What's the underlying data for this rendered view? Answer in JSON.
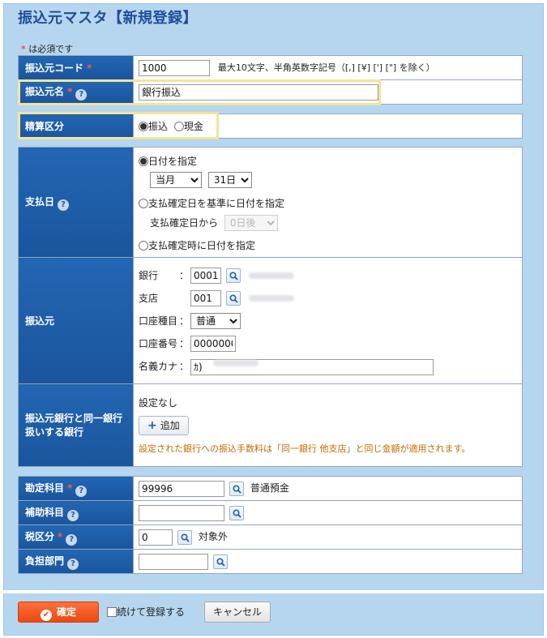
{
  "page": {
    "title": "振込元マスタ【新規登録】"
  },
  "required_note": {
    "star": "*",
    "text": "は必須です"
  },
  "colors": {
    "header_bg": "#1e5ea9",
    "frame_bg": "#b6d6ef",
    "accent_orange": "#ea4a14",
    "required_star": "#ff4d3d"
  },
  "fields": {
    "code": {
      "label": "振込元コード",
      "value": "1000",
      "hint": "最大10文字、半角英数字記号（[,] [¥] ['] [\"] を除く）"
    },
    "name": {
      "label": "振込元名",
      "value": "銀行振込"
    },
    "settlement": {
      "label": "精算区分",
      "options": [
        "振込",
        "現金"
      ],
      "selected": "振込"
    },
    "payday": {
      "label": "支払日",
      "opt_specify": "日付を指定",
      "month_select": "当月",
      "day_select": "31日",
      "opt_confirm_base": "支払確定日を基準に日付を指定",
      "confirm_from_label": "支払確定日から",
      "confirm_days_select": "0日後",
      "opt_confirm_time": "支払確定時に日付を指定"
    },
    "source": {
      "label": "振込元",
      "bank_label": "銀行",
      "bank_value": "0001",
      "branch_label": "支店",
      "branch_value": "001",
      "acct_type_label": "口座種目",
      "acct_type_value": "普通",
      "acct_no_label": "口座番号",
      "acct_no_value": "0000000",
      "kana_label": "名義カナ",
      "kana_value": "ｶ)",
      "colon": "："
    },
    "same_bank": {
      "label_line1": "振込元銀行と同一銀行",
      "label_line2": "扱いする銀行",
      "status": "設定なし",
      "add_label": "追加",
      "note": "設定された銀行への振込手数料は「同一銀行 他支店」と同じ金額が適用されます。"
    },
    "account_subject": {
      "label": "勘定科目",
      "value": "99996",
      "result": "普通預金"
    },
    "sub_subject": {
      "label": "補助科目",
      "value": ""
    },
    "tax_class": {
      "label": "税区分",
      "value": "0",
      "result": "対象外"
    },
    "dept": {
      "label": "負担部門",
      "value": ""
    }
  },
  "footer": {
    "confirm_label": "確定",
    "continue_label": "続けて登録する",
    "cancel_label": "キャンセル"
  }
}
